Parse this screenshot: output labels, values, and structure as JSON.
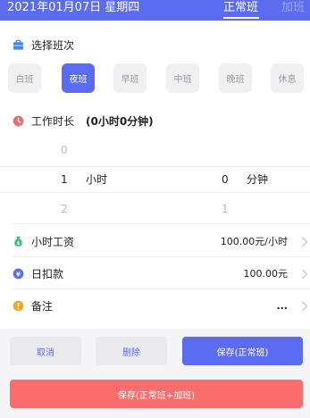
{
  "header": {
    "date": "2021年01月07日 星期四",
    "tab_active": "正常班",
    "tab_inactive": "加班"
  },
  "shift_section": {
    "title": "选择班次",
    "options": [
      "白班",
      "夜班",
      "早班",
      "中班",
      "晚班",
      "休息"
    ],
    "selected": "夜班"
  },
  "duration": {
    "label": "工作时长",
    "summary": "(0小时0分钟)",
    "hours_above": "0",
    "hours_selected": "1",
    "hours_below": "2",
    "hours_unit": "小时",
    "minutes_selected": "0",
    "minutes_below": "1",
    "minutes_unit": "分钟"
  },
  "hourly_wage": {
    "label": "小时工资",
    "value": "100.00元/小时"
  },
  "daily_deduction": {
    "label": "日扣款",
    "value": "100.00元"
  },
  "note": {
    "label": "备注",
    "value": "..."
  },
  "buttons": {
    "cancel": "取消",
    "delete": "删除",
    "save_normal": "保存(正常班)",
    "save_normal_overtime": "保存(正常班+加班)"
  },
  "colors": {
    "primary": "#5b6cf0",
    "danger": "#fb6c6c"
  },
  "icons": {
    "shift": "briefcase-icon",
    "duration": "clock-icon",
    "wage": "money-bag-icon",
    "deduction": "yen-coin-icon",
    "note": "exclamation-icon"
  }
}
